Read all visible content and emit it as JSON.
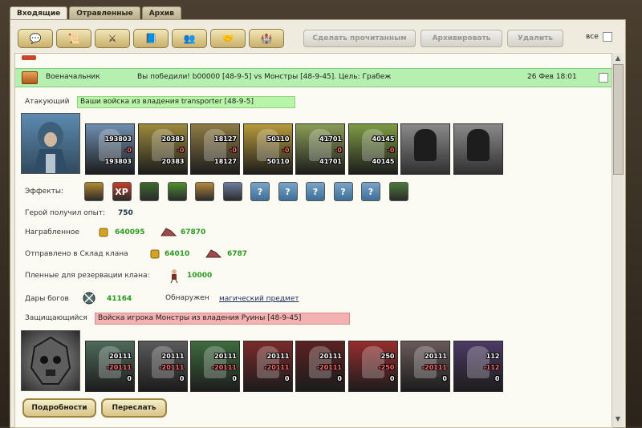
{
  "tabs": [
    {
      "label": "Входящие",
      "active": true
    },
    {
      "label": "Отравленные",
      "active": false
    },
    {
      "label": "Архив",
      "active": false
    }
  ],
  "toolbar": {
    "icon_buttons": [
      "talk-icon",
      "scroll-icon",
      "sword-icon",
      "book-icon",
      "heroes-icon",
      "handshake-icon",
      "castle-icon"
    ],
    "mark_read_label": "Сделать прочитанным",
    "archive_label": "Архивировать",
    "delete_label": "Удалить",
    "all_label": "все"
  },
  "message": {
    "sender": "Военачальник",
    "subject": "Вы победили! b00000 [48-9-5] vs Монстры [48-9-45]. Цель: Грабеж",
    "date": "26 Фев 18:01"
  },
  "attacker": {
    "label": "Атакующий",
    "name": "Ваши войска из владения transporter [48-9-5]",
    "units": [
      {
        "icon": "knight-unit",
        "top": "193803",
        "loss": "-0",
        "bottom": "193803"
      },
      {
        "icon": "archer-unit",
        "top": "20383",
        "loss": "-0",
        "bottom": "20383"
      },
      {
        "icon": "swordsman-unit",
        "top": "18127",
        "loss": "-0",
        "bottom": "18127"
      },
      {
        "icon": "griffin-unit",
        "top": "50110",
        "loss": "-0",
        "bottom": "50110"
      },
      {
        "icon": "mage-unit",
        "top": "41701",
        "loss": "-0",
        "bottom": "41701"
      },
      {
        "icon": "paladin-unit",
        "top": "40145",
        "loss": "-0",
        "bottom": "40145"
      },
      {
        "icon": "locked-unit",
        "top": "",
        "loss": "",
        "bottom": ""
      },
      {
        "icon": "locked-unit",
        "top": "",
        "loss": "",
        "bottom": ""
      }
    ]
  },
  "effects": {
    "label": "Эффекты:",
    "items": [
      "knight-icon",
      "XP",
      "xp-tree-icon",
      "sword-icon",
      "handshake-icon",
      "boot-icon",
      "?",
      "?",
      "?",
      "?",
      "?",
      "laurel-icon"
    ]
  },
  "stats": {
    "exp_label": "Герой получил опыт:",
    "exp_value": "750",
    "loot_label": "Награбленное",
    "loot_gold": "640095",
    "loot_ore": "67870",
    "clan_label": "Отправлено в Склад клана",
    "clan_gold": "64010",
    "clan_ore": "6787",
    "prisoners_label": "Пленные для резервации клана:",
    "prisoners_value": "10000",
    "gifts_label": "Дары богов",
    "gifts_value": "41164",
    "found_label": "Обнаружен",
    "found_link": "магический предмет"
  },
  "defender": {
    "label": "Защищающийся",
    "name": "Войска игрока Монстры из владения Руины [48-9-45]",
    "units": [
      {
        "icon": "zombie-unit",
        "top": "20111",
        "loss": "-20111",
        "bottom": "0"
      },
      {
        "icon": "orc-unit",
        "top": "20111",
        "loss": "-20111",
        "bottom": "0"
      },
      {
        "icon": "goblin-unit",
        "top": "20111",
        "loss": "-20111",
        "bottom": "0"
      },
      {
        "icon": "demon-unit",
        "top": "20111",
        "loss": "-20111",
        "bottom": "0"
      },
      {
        "icon": "spider-unit",
        "top": "20111",
        "loss": "-20111",
        "bottom": "0"
      },
      {
        "icon": "dragon-unit",
        "top": "250",
        "loss": "-250",
        "bottom": "0"
      },
      {
        "icon": "skeleton-unit",
        "top": "20111",
        "loss": "-20111",
        "bottom": "0"
      },
      {
        "icon": "lich-unit",
        "top": "112",
        "loss": "-112",
        "bottom": "0"
      }
    ]
  },
  "buttons": {
    "details": "Подробности",
    "forward": "Переслать"
  },
  "colors": {
    "header_green": "#b5f0b0",
    "attacker_box": "#b9f5a8",
    "defender_box": "#f4b1b1",
    "value_green": "#2a9a1f"
  }
}
